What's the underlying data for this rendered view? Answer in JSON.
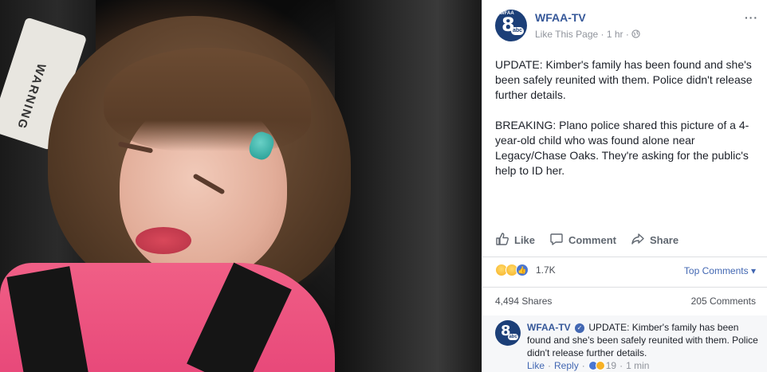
{
  "photo": {
    "tag_text": "WARNING"
  },
  "post": {
    "page_name": "WFAA-TV",
    "like_page": "Like This Page",
    "time": "1 hr",
    "separator": "·",
    "more": "···",
    "body": "UPDATE: Kimber's family has been found and she's been safely reunited with them. Police didn't release further details.\n\nBREAKING: Plano police shared this picture of a 4-year-old child who was found alone near Legacy/Chase Oaks. They're asking for the public's help to ID her.",
    "actions": {
      "like": "Like",
      "comment": "Comment",
      "share": "Share"
    },
    "reactions_count": "1.7K",
    "top_comments": "Top Comments",
    "shares": "4,494 Shares",
    "comments_count": "205 Comments",
    "avatar": {
      "number": "8",
      "abc": "abc",
      "mini": "WFAA"
    }
  },
  "comment": {
    "author": "WFAA-TV",
    "text": "UPDATE: Kimber's family has been found and she's been safely reunited with them. Police didn't release further details.",
    "like": "Like",
    "reply": "Reply",
    "reaction_count": "19",
    "time": "1 min",
    "dot": "·"
  },
  "colors": {
    "link_blue": "#365899",
    "accent_blue": "#4267b2",
    "meta_gray": "#90949c",
    "shirt_pink": "#f05f86"
  }
}
